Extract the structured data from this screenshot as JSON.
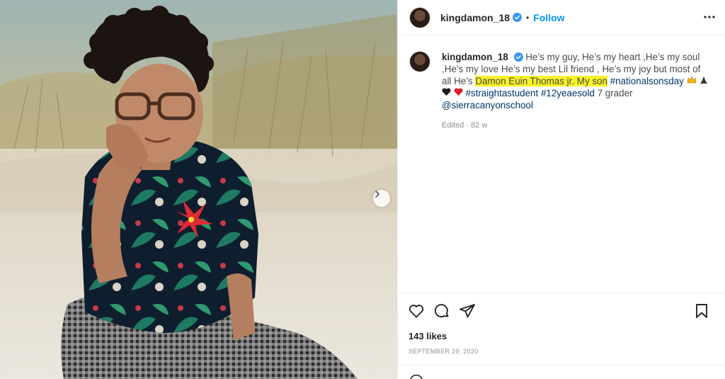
{
  "post": {
    "username": "kingdamon_18",
    "separator": "•",
    "follow_label": "Follow",
    "caption": {
      "text_1": "He’s my guy, He’s my heart ,He’s my soul ,He’s my love He’s my best Lil friend , He’s my joy but most of all He’s ",
      "highlight": "Damon Euin Thomas jr. My son",
      "hashtag_1": "#nationalsonsday",
      "emojis": [
        "crown-emoji",
        "praying-hands-emoji",
        "black-heart-emoji",
        "red-heart-emoji"
      ],
      "hashtag_2": "#straightastudent",
      "hashtag_3": "#12yeaesold",
      "text_2": " 7 grader ",
      "mention": "@sierracanyonschool"
    },
    "meta": "Edited · 82 w",
    "likes": "143 likes",
    "date": "SEPTEMBER 29, 2020"
  },
  "icons": {
    "like": "heart-icon",
    "comment": "comment-icon",
    "share": "paper-plane-icon",
    "save": "bookmark-icon",
    "more": "more-options-icon",
    "next": "chevron-right-icon"
  },
  "colors": {
    "accent": "#0095f6",
    "highlight": "#f7f327",
    "hashtag": "#00376b",
    "muted": "#8e8e8e"
  }
}
